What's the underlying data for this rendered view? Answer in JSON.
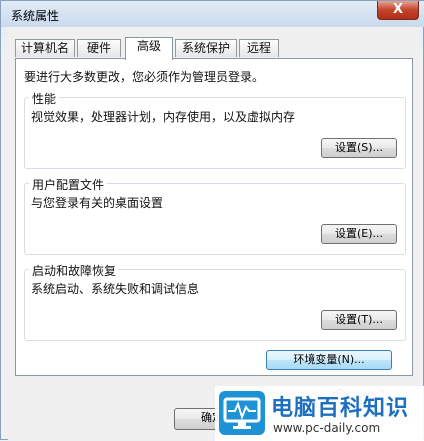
{
  "window": {
    "title": "系统属性",
    "close_label": "X"
  },
  "tabs": [
    {
      "label": "计算机名",
      "active": false
    },
    {
      "label": "硬件",
      "active": false
    },
    {
      "label": "高级",
      "active": true
    },
    {
      "label": "系统保护",
      "active": false
    },
    {
      "label": "远程",
      "active": false
    }
  ],
  "advanced": {
    "intro": "要进行大多数更改，您必须作为管理员登录。",
    "performance": {
      "title": "性能",
      "description": "视觉效果，处理器计划，内存使用，以及虚拟内存",
      "button": "设置(S)..."
    },
    "profiles": {
      "title": "用户配置文件",
      "description": "与您登录有关的桌面设置",
      "button": "设置(E)..."
    },
    "startup": {
      "title": "启动和故障恢复",
      "description": "系统启动、系统失败和调试信息",
      "button": "设置(T)..."
    },
    "env_button": "环境变量(N)..."
  },
  "footer": {
    "ok_label": "确定"
  },
  "watermark": {
    "brand": "电脑百科知识",
    "url": "www.pc-daily.com"
  },
  "colors": {
    "accent": "#3c7fb1",
    "watermark_blue": "#1d93d6"
  }
}
